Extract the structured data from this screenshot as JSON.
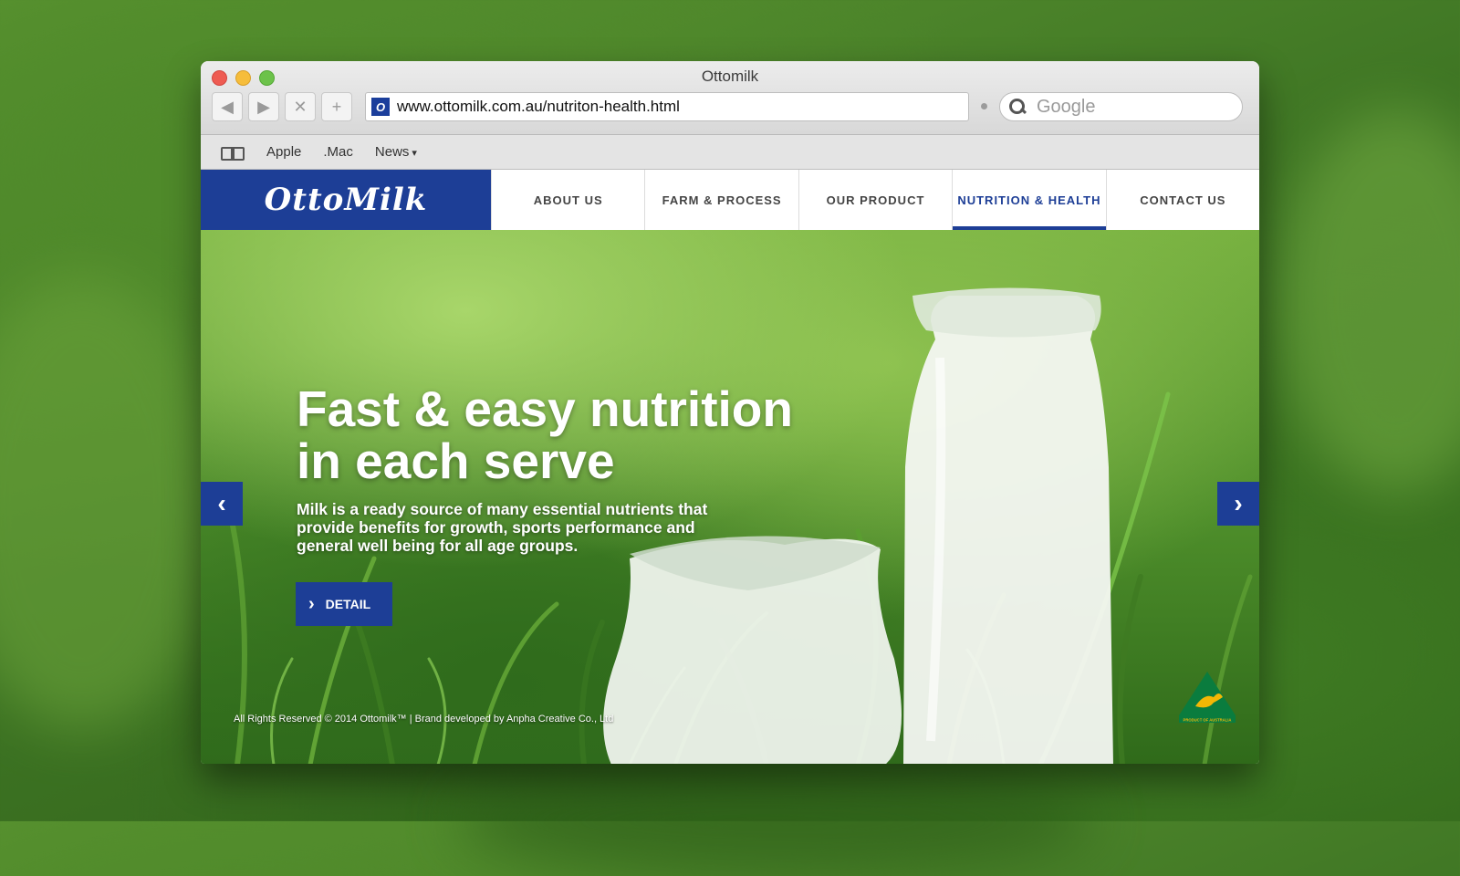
{
  "window": {
    "title": "Ottomilk",
    "url": "www.ottomilk.com.au/nutriton-health.html",
    "favicon_letter": "O",
    "search_placeholder": "Google",
    "nav_buttons": {
      "back": "◀",
      "forward": "▶",
      "stop": "✕",
      "add": "+"
    }
  },
  "bookmarks": {
    "items": [
      "Apple",
      ".Mac",
      "News"
    ],
    "news_arrow": "▾"
  },
  "site": {
    "logo": "OttoMilk",
    "menu": [
      {
        "label": "ABOUT US"
      },
      {
        "label": "FARM & PROCESS"
      },
      {
        "label": "OUR PRODUCT"
      },
      {
        "label": "NUTRITION & HEALTH"
      },
      {
        "label": "CONTACT US"
      }
    ],
    "active_menu": "NUTRITION & HEALTH"
  },
  "hero": {
    "title_line1": "Fast & easy nutrition",
    "title_line2": "in each serve",
    "description": "Milk is a ready source of many essential nutrients that provide benefits for growth, sports performance and general well being for all age groups.",
    "button_label": "DETAIL",
    "button_icon": "›",
    "prev_arrow": "‹",
    "next_arrow": "›",
    "footer": "All Rights Reserved © 2014 Ottomilk™ | Brand developed by Anpha Creative Co., Ltd",
    "badge_text": "PRODUCT OF AUSTRALIA"
  },
  "colors": {
    "brand_blue": "#1d3e96",
    "traffic_red": "#ee5b52",
    "traffic_yellow": "#f6bd3b",
    "traffic_green": "#6cc24a",
    "badge_green": "#0a7c3e",
    "badge_gold": "#f2b705"
  },
  "icons": {
    "close": "close-dot-icon",
    "minimize": "minimize-dot-icon",
    "zoom": "zoom-dot-icon",
    "bookmarks": "open-book-icon",
    "search": "magnifier-icon",
    "badge": "kangaroo-triangle-icon"
  }
}
